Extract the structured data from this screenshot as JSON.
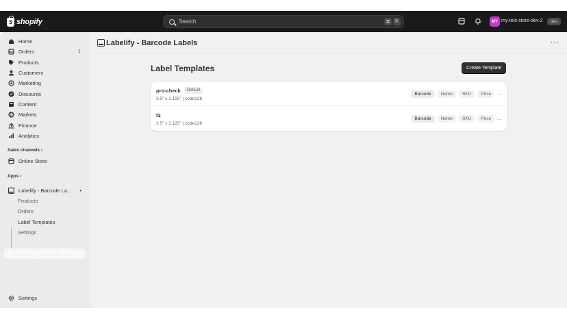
{
  "topbar": {
    "brand": "shopify",
    "brand_mark": "S",
    "search_placeholder": "Search",
    "shortcut_keys": [
      "⌘",
      "K"
    ],
    "avatar_initials": "MY",
    "store_name": "my-test-store-dev-2",
    "env_badge": "dev"
  },
  "sidebar": {
    "items": [
      {
        "label": "Home",
        "icon": "home-icon"
      },
      {
        "label": "Orders",
        "icon": "orders-icon",
        "count": "1"
      },
      {
        "label": "Products",
        "icon": "tag-icon"
      },
      {
        "label": "Customers",
        "icon": "person-icon"
      },
      {
        "label": "Marketing",
        "icon": "target-icon"
      },
      {
        "label": "Discounts",
        "icon": "discount-icon"
      },
      {
        "label": "Content",
        "icon": "content-icon"
      },
      {
        "label": "Markets",
        "icon": "globe-icon"
      },
      {
        "label": "Finance",
        "icon": "bank-icon"
      },
      {
        "label": "Analytics",
        "icon": "chart-icon"
      }
    ],
    "sales_channels_label": "Sales channels",
    "online_store_label": "Online Store",
    "apps_label": "Apps",
    "app_name": "Labelify - Barcode La...",
    "app_subitems": [
      "Products",
      "Orders",
      "Label Templates",
      "Settings"
    ],
    "settings_label": "Settings"
  },
  "main": {
    "app_title": "Labelify - Barcode Labels",
    "more_label": "···",
    "heading": "Label Templates",
    "create_button": "Create Template",
    "templates": [
      {
        "name": "pro-check",
        "badge": "Default",
        "meta": "3.5\" x 1.125\" | code128",
        "fields": [
          "Barcode",
          "Name",
          "SKU",
          "Price"
        ],
        "more": "..."
      },
      {
        "name": "t3",
        "badge": "",
        "meta": "3.5\" x 1.125\" | code128",
        "fields": [
          "Barcode",
          "Name",
          "SKU",
          "Price"
        ],
        "more": "..."
      }
    ]
  },
  "colors": {
    "topbar": "#1a1a1a",
    "sidebar": "#ebebeb",
    "main": "#f1f1f1",
    "primary_button": "#303030",
    "avatar": "#c539c9"
  }
}
